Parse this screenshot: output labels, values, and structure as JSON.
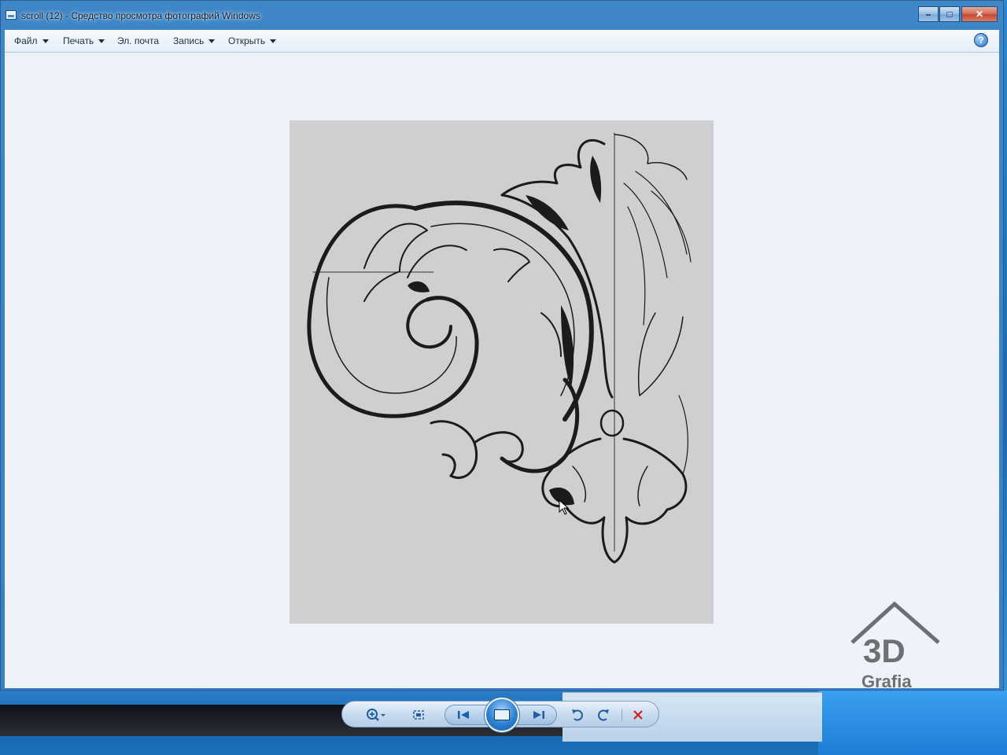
{
  "window": {
    "title": "scroll (12) - Средство просмотра фотографий Windows",
    "controls": {
      "minimize": "–",
      "maximize": "□",
      "close": "✕"
    }
  },
  "menu": {
    "items": [
      {
        "label": "Файл",
        "has_dropdown": true
      },
      {
        "label": "Печать",
        "has_dropdown": true
      },
      {
        "label": "Эл. почта",
        "has_dropdown": false
      },
      {
        "label": "Запись",
        "has_dropdown": true
      },
      {
        "label": "Открыть",
        "has_dropdown": true
      }
    ],
    "help_label": "?"
  },
  "image": {
    "description_icon": "ornamental-acanthus-scroll-drawing",
    "background_color": "#cfcfd1"
  },
  "watermark": {
    "text_top": "3D",
    "text_bottom": "Grafia"
  },
  "toolbar": {
    "zoom_icon": "zoom-icon",
    "fit_icon": "actual-size-icon",
    "prev_icon": "previous-icon",
    "slideshow_icon": "slideshow-icon",
    "next_icon": "next-icon",
    "rotate_left_icon": "rotate-counterclockwise-icon",
    "rotate_right_icon": "rotate-clockwise-icon",
    "delete_icon": "delete-icon",
    "delete_color": "#d21f1f"
  },
  "colors": {
    "window_frame": "#3e86c7",
    "content_bg": "#eef3fa",
    "accent": "#1f5ea3"
  }
}
